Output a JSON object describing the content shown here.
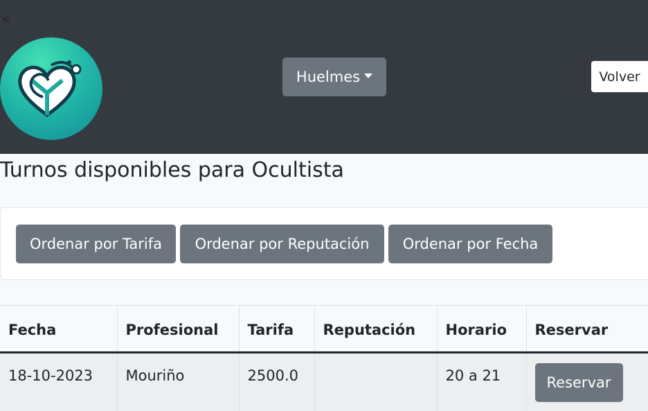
{
  "header": {
    "back_link": "<",
    "logo_icon": "heart-stethoscope-logo-icon",
    "city_dropdown": "Huelmes",
    "back_button": "Volver",
    "colors": {
      "navbar": "#343a40",
      "button": "#6c757d",
      "logo_light": "#43e0b4",
      "logo_dark": "#128c97"
    }
  },
  "main": {
    "title": "Turnos disponibles para Ocultista",
    "sort_buttons": [
      "Ordenar por Tarifa",
      "Ordenar por Reputación",
      "Ordenar por Fecha"
    ]
  },
  "table": {
    "headers": [
      "Fecha",
      "Profesional",
      "Tarifa",
      "Reputación",
      "Horario",
      "Reservar"
    ],
    "rows": [
      {
        "fecha": "18-10-2023",
        "profesional": "Mouriño",
        "tarifa": "2500.0",
        "reputacion": "",
        "horario": "20 a 21",
        "reservar_label": "Reservar"
      }
    ]
  }
}
